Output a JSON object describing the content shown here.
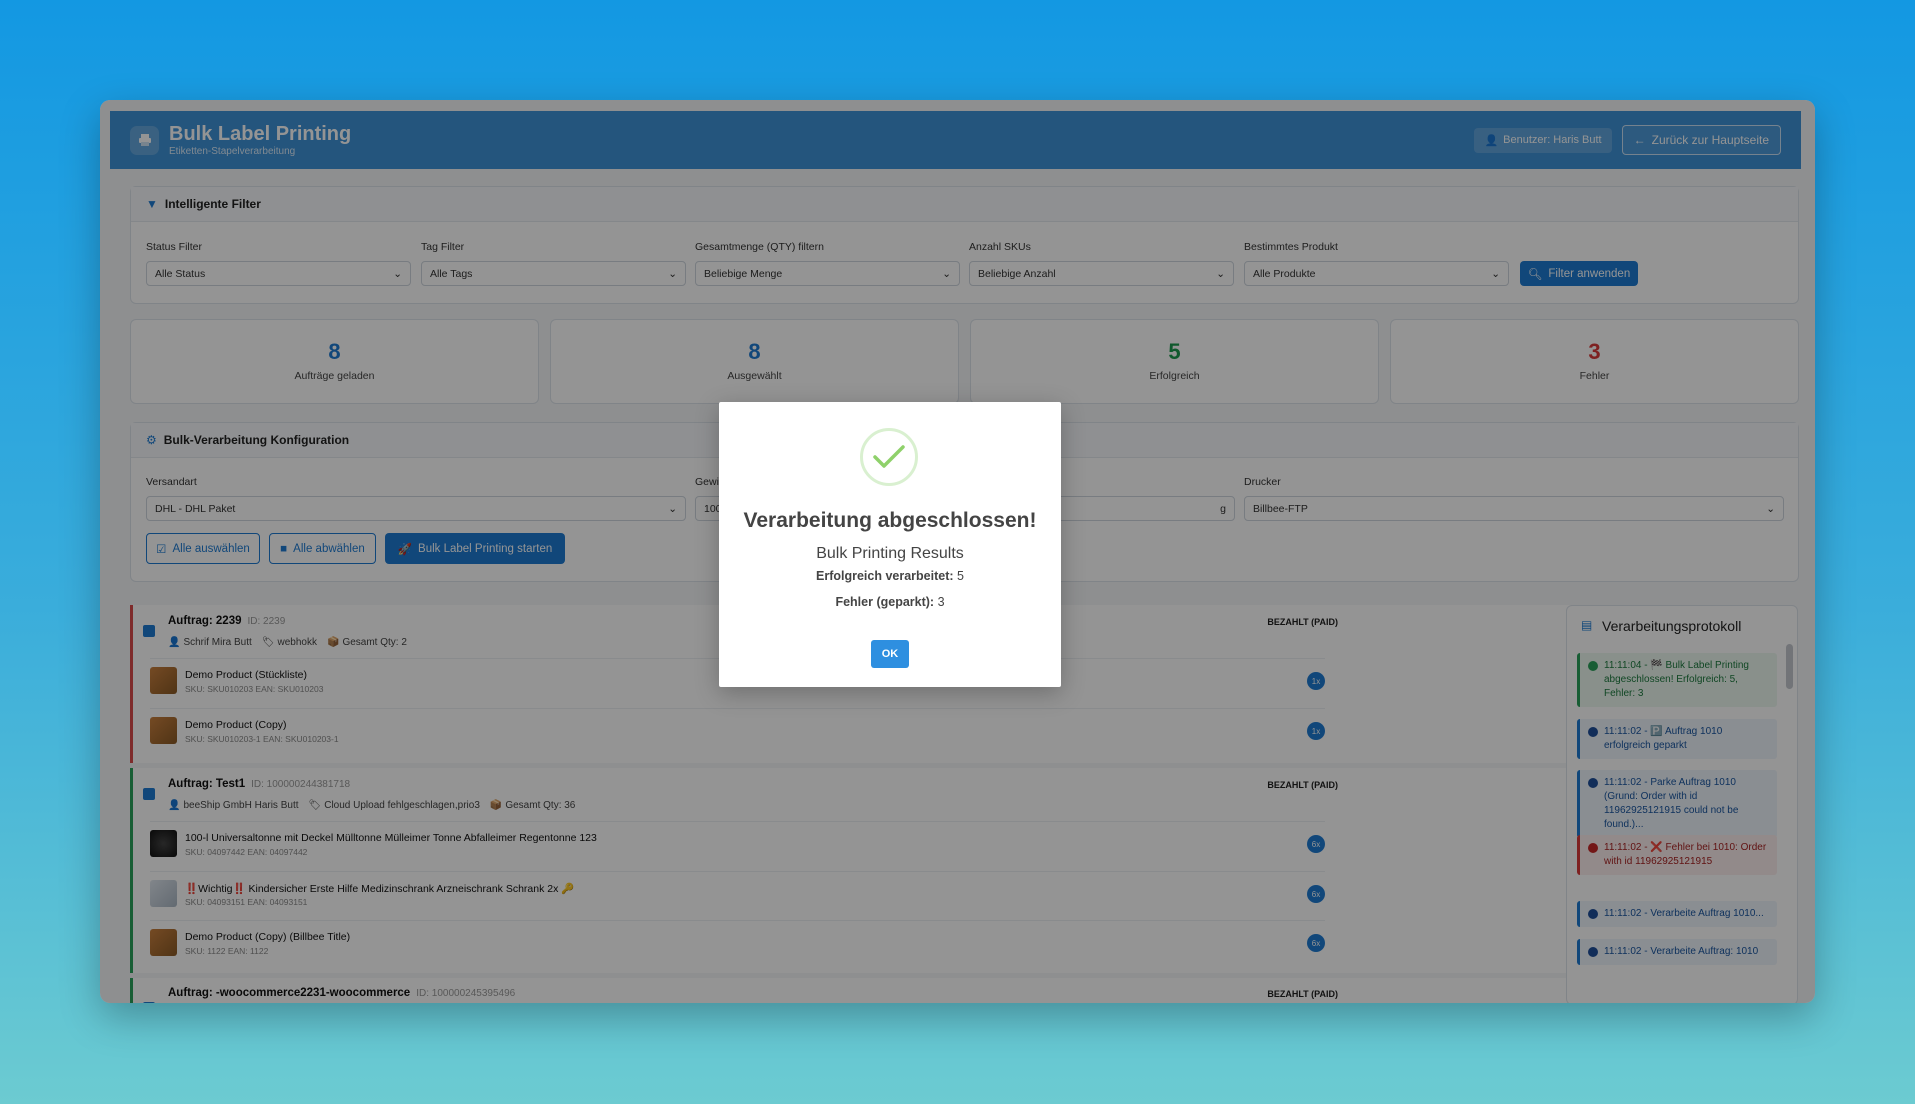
{
  "header": {
    "title": "Bulk Label Printing",
    "subtitle": "Etiketten-Stapelverarbeitung",
    "user_label": "Benutzer: Haris Butt",
    "back_label": "Zurück zur Hauptseite"
  },
  "filters": {
    "title": "Intelligente Filter",
    "status": {
      "label": "Status Filter",
      "value": "Alle Status"
    },
    "tag": {
      "label": "Tag Filter",
      "value": "Alle Tags"
    },
    "qty": {
      "label": "Gesamtmenge (QTY) filtern",
      "value": "Beliebige Menge"
    },
    "skus": {
      "label": "Anzahl SKUs",
      "value": "Beliebige Anzahl"
    },
    "product": {
      "label": "Bestimmtes Produkt",
      "value": "Alle Produkte"
    },
    "apply_label": "Filter anwenden"
  },
  "stats": [
    {
      "value": "8",
      "label": "Aufträge geladen",
      "color": "#1e7bd3"
    },
    {
      "value": "8",
      "label": "Ausgewählt",
      "color": "#1e7bd3"
    },
    {
      "value": "5",
      "label": "Erfolgreich",
      "color": "#1d9a4e"
    },
    {
      "value": "3",
      "label": "Fehler",
      "color": "#d93a3a"
    }
  ],
  "config": {
    "title": "Bulk-Verarbeitung Konfiguration",
    "shipping": {
      "label": "Versandart",
      "value": "DHL - DHL Paket"
    },
    "weight": {
      "label": "Gewi",
      "value": "100",
      "unit": "g"
    },
    "printer": {
      "label": "Drucker",
      "value": "Billbee-FTP"
    },
    "select_all": "Alle auswählen",
    "deselect_all": "Alle abwählen",
    "start": "Bulk Label Printing starten"
  },
  "orders": [
    {
      "title": "Auftrag: 2239",
      "id": "ID: 2239",
      "status": "BEZAHLT (PAID)",
      "customer": "Schrif Mira Butt",
      "tags": "webhokk",
      "total": "Gesamt Qty: 2",
      "items": [
        {
          "name": "Demo Product (Stückliste)",
          "sub": "SKU: SKU010203    EAN: SKU010203",
          "qty": "1x"
        },
        {
          "name": "Demo Product (Copy)",
          "sub": "SKU: SKU010203-1    EAN: SKU010203-1",
          "qty": "1x"
        }
      ]
    },
    {
      "title": "Auftrag: Test1",
      "id": "ID: 100000244381718",
      "status": "BEZAHLT (PAID)",
      "customer": "beeShip GmbH Haris Butt",
      "tags": "Cloud Upload fehlgeschlagen,prio3",
      "total": "Gesamt Qty: 36",
      "items": [
        {
          "name": "100-l Universaltonne mit Deckel Mülltonne Mülleimer Tonne Abfalleimer Regentonne 123",
          "sub": "SKU: 04097442    EAN: 04097442",
          "qty": "6x"
        },
        {
          "name": "‼️Wichtig‼️ Kindersicher Erste Hilfe Medizinschrank Arzneischrank Schrank 2x 🔑",
          "sub": "SKU: 04093151    EAN: 04093151",
          "qty": "6x"
        },
        {
          "name": "Demo Product (Copy) (Billbee Title)",
          "sub": "SKU: 1122    EAN: 1122",
          "qty": "6x"
        }
      ]
    },
    {
      "title": "Auftrag: -woocommerce2231-woocommerce",
      "id": "ID: 100000245395496",
      "status": "BEZAHLT (PAID)"
    }
  ],
  "log": {
    "title": "Verarbeitungsprotokoll",
    "entries": [
      {
        "text": "11:11:04 - 🏁 Bulk Label Printing abgeschlossen! Erfolgreich: 5, Fehler: 3",
        "kind": "success"
      },
      {
        "text": "11:11:02 - 🅿️ Auftrag 1010 erfolgreich geparkt",
        "kind": "info"
      },
      {
        "text": "11:11:02 - Parke Auftrag 1010 (Grund: Order with id 11962925121915 could not be found.)...",
        "kind": "info"
      },
      {
        "text": "11:11:02 - ❌ Fehler bei 1010: Order with id 11962925121915",
        "kind": "error"
      },
      {
        "text": "11:11:02 - Verarbeite Auftrag 1010...",
        "kind": "info"
      },
      {
        "text": "11:11:02 - Verarbeite Auftrag: 1010",
        "kind": "info"
      }
    ]
  },
  "modal": {
    "title": "Verarbeitung abgeschlossen!",
    "subtitle": "Bulk Printing Results",
    "success_label": "Erfolgreich verarbeitet:",
    "success_value": "5",
    "error_label": "Fehler (geparkt):",
    "error_value": "3",
    "ok_label": "OK"
  }
}
